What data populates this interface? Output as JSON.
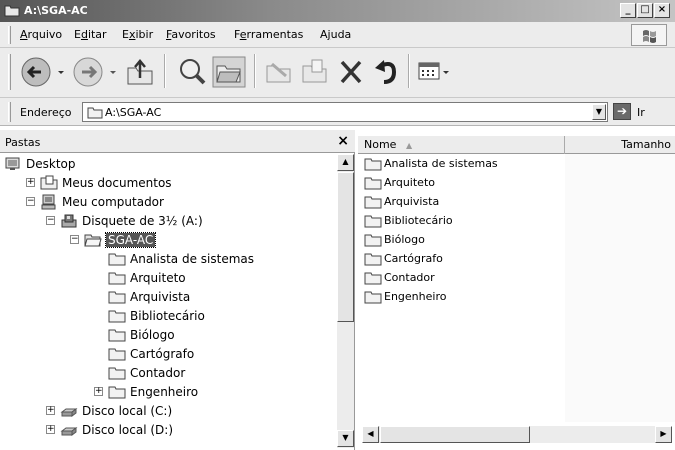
{
  "window": {
    "title": "A:\\SGA-AC"
  },
  "menubar": {
    "items": [
      {
        "label": "Arquivo",
        "accel": "A",
        "rest": "rquivo"
      },
      {
        "label": "Editar",
        "accel": "d",
        "pre": "E",
        "rest": "itar"
      },
      {
        "label": "Exibir",
        "accel": "x",
        "pre": "E",
        "rest": "ibir"
      },
      {
        "label": "Favoritos",
        "accel": "F",
        "rest": "avoritos"
      },
      {
        "label": "Ferramentas",
        "pre": "F",
        "accel": "e",
        "rest": "rramentas"
      },
      {
        "label": "Ajuda",
        "pre": "A",
        "accel": "j",
        "rest": "uda"
      }
    ]
  },
  "toolbar": {
    "buttons": [
      "back",
      "forward",
      "up",
      "search",
      "folders",
      "move-to",
      "copy-to",
      "delete",
      "undo",
      "views"
    ]
  },
  "addressbar": {
    "label": "Endereço",
    "value": "A:\\SGA-AC",
    "go_label": "Ir"
  },
  "folders": {
    "title": "Pastas",
    "tree": [
      {
        "label": "Desktop",
        "icon": "desktop-icon",
        "level": 0,
        "expander": ""
      },
      {
        "label": "Meus documentos",
        "icon": "documents-folder-icon",
        "level": 1,
        "expander": "+"
      },
      {
        "label": "Meu computador",
        "icon": "computer-icon",
        "level": 1,
        "expander": "−"
      },
      {
        "label": "Disquete de 3½ (A:)",
        "icon": "floppy-drive-icon",
        "level": 2,
        "expander": "−"
      },
      {
        "label": "SGA-AC",
        "icon": "folder-open-icon",
        "level": 3,
        "expander": "−",
        "selected": true
      },
      {
        "label": "Analista de sistemas",
        "icon": "folder-icon",
        "level": 4,
        "expander": ""
      },
      {
        "label": "Arquiteto",
        "icon": "folder-icon",
        "level": 4,
        "expander": ""
      },
      {
        "label": "Arquivista",
        "icon": "folder-icon",
        "level": 4,
        "expander": ""
      },
      {
        "label": "Bibliotecário",
        "icon": "folder-icon",
        "level": 4,
        "expander": ""
      },
      {
        "label": "Biólogo",
        "icon": "folder-icon",
        "level": 4,
        "expander": ""
      },
      {
        "label": "Cartógrafo",
        "icon": "folder-icon",
        "level": 4,
        "expander": ""
      },
      {
        "label": "Contador",
        "icon": "folder-icon",
        "level": 4,
        "expander": ""
      },
      {
        "label": "Engenheiro",
        "icon": "folder-icon",
        "level": 4,
        "expander": "+"
      },
      {
        "label": "Disco local (C:)",
        "icon": "hard-drive-icon",
        "level": 2,
        "expander": "+"
      },
      {
        "label": "Disco local (D:)",
        "icon": "hard-drive-icon",
        "level": 2,
        "expander": "+"
      }
    ]
  },
  "content": {
    "columns": [
      {
        "label": "Nome",
        "sort": "ascending"
      },
      {
        "label": "Tamanho"
      }
    ],
    "files": [
      "Analista de sistemas",
      "Arquiteto",
      "Arquivista",
      "Bibliotecário",
      "Biólogo",
      "Cartógrafo",
      "Contador",
      "Engenheiro"
    ]
  }
}
